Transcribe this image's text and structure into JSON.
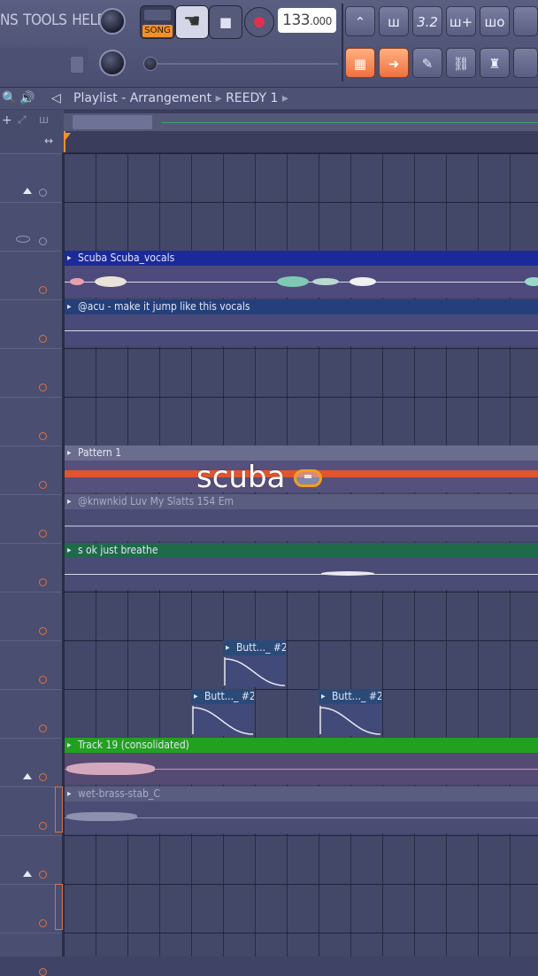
{
  "menu": {
    "items": [
      "NS",
      "TOOLS",
      "HELP"
    ]
  },
  "transport": {
    "mode_label": "SONG",
    "stop_glyph": "■",
    "tempo_int": "133",
    "tempo_dec": ".000"
  },
  "playlist": {
    "icon1": "🔍",
    "icon2": "🔊",
    "icon3": "◁",
    "title": "Playlist - Arrangement",
    "separator": "▸",
    "pattern_name": "REEDY 1",
    "separator2": "▸"
  },
  "tools": [
    "⌃",
    "ш",
    "3.2",
    "ш+",
    "шo"
  ],
  "tools2": [
    "▦",
    "➜",
    "✎",
    "⛓",
    "♜"
  ],
  "clips": [
    {
      "label": "Scuba Scuba_vocals",
      "color": "#1b2a9a"
    },
    {
      "label": "@acu - make it jump like this vocals",
      "color": "#243f7a"
    },
    {
      "label": "Pattern 1",
      "color": "#6a6d8e"
    },
    {
      "label": "@knwnkid Luv My Slatts 154 Em",
      "color": "#5a5d80"
    },
    {
      "label": "s ok just breathe",
      "color": "#1e6a4a"
    },
    {
      "label": "Butt..._ #2",
      "color": "#2b4a78"
    },
    {
      "label": "Butt..._ #2",
      "color": "#2b4a78"
    },
    {
      "label": "Butt..._ #2",
      "color": "#2b4a78"
    },
    {
      "label": "Track 19 (consolidated)",
      "color": "#22a020"
    },
    {
      "label": "wet-brass-stab_C",
      "color": "#5a5d80"
    }
  ],
  "overlay": {
    "text": "scuba"
  },
  "colors": {
    "accent_orange": "#f0902a",
    "record_red": "#e03050",
    "bg": "#434768"
  }
}
